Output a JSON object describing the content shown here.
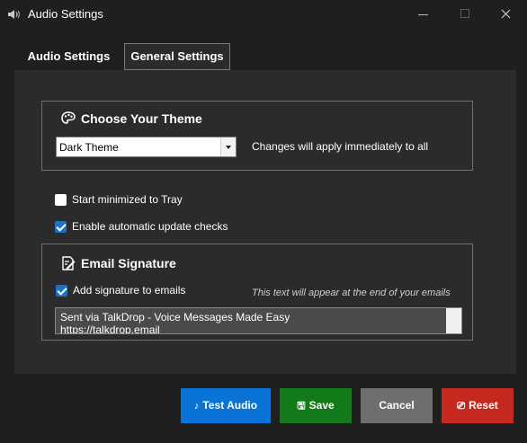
{
  "window": {
    "title": "Audio Settings",
    "app_icon": "speaker-icon",
    "controls": [
      "minimize-icon",
      "maximize-icon",
      "close-icon"
    ]
  },
  "tabs": [
    {
      "label": "Audio Settings",
      "selected": false
    },
    {
      "label": "General Settings",
      "selected": true
    }
  ],
  "theme": {
    "title": "Choose Your Theme",
    "icon": "palette-icon",
    "selected": "Dark Theme",
    "hint": "Changes will apply immediately to all"
  },
  "options": {
    "start_minimized": {
      "label": "Start minimized to Tray",
      "checked": false
    },
    "auto_update": {
      "label": "Enable automatic update checks",
      "checked": true
    }
  },
  "email": {
    "title": "Email Signature",
    "icon": "edit-document-icon",
    "add_signature": {
      "label": "Add signature to emails",
      "checked": true
    },
    "hint": "This text will appear at the end of your emails",
    "lines": [
      "Sent via TalkDrop - Voice Messages Made Easy",
      "https://talkdrop.email"
    ]
  },
  "buttons": {
    "test": {
      "label": "Test Audio",
      "glyph": "♪",
      "icon": "music-note-icon",
      "color": "#0a74d6"
    },
    "save": {
      "label": "Save",
      "glyph": "🖫",
      "icon": "save-icon",
      "color": "#127a18"
    },
    "cancel": {
      "label": "Cancel",
      "color": "#6e6e6e"
    },
    "reset": {
      "label": "Reset",
      "glyph": "⎚",
      "icon": "reset-icon",
      "color": "#c4281e"
    }
  },
  "colors": {
    "background": "#1f1f1f",
    "panel": "#2b2b2b",
    "accent": "#1a73c9"
  }
}
